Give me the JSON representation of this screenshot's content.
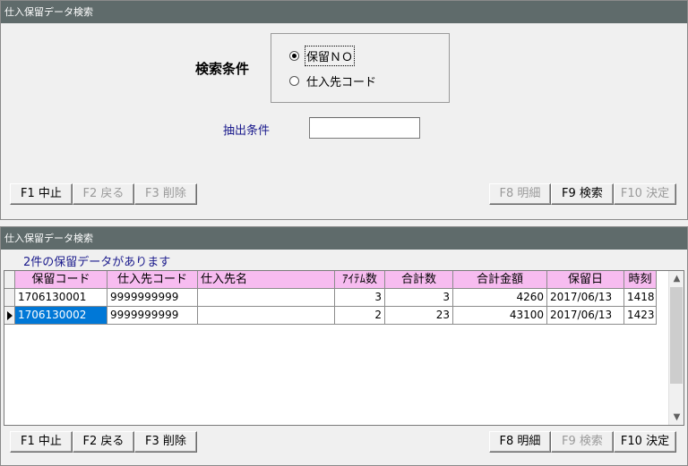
{
  "top_panel": {
    "title": "仕入保留データ検索",
    "search_condition_label": "検索条件",
    "radio_options": [
      {
        "label": "保留ＮＯ",
        "checked": true
      },
      {
        "label": "仕入先コード",
        "checked": false
      }
    ],
    "extract_label": "抽出条件",
    "extract_value": "",
    "buttons": {
      "f1": "F1 中止",
      "f2": "F2 戻る",
      "f3": "F3 削除",
      "f8": "F8 明細",
      "f9": "F9 検索",
      "f10": "F10 決定"
    }
  },
  "bottom_panel": {
    "title": "仕入保留データ検索",
    "count_message": "2件の保留データがあります",
    "columns": [
      "保留コード",
      "仕入先コード",
      "仕入先名",
      "ｱｲﾃﾑ数",
      "合計数",
      "合計金額",
      "保留日",
      "時刻"
    ],
    "rows": [
      {
        "code": "1706130001",
        "supplier_code": "9999999999",
        "supplier_name": "",
        "items": "3",
        "total_qty": "3",
        "total_amount": "4260",
        "date": "2017/06/13",
        "time": "1418"
      },
      {
        "code": "1706130002",
        "supplier_code": "9999999999",
        "supplier_name": "",
        "items": "2",
        "total_qty": "23",
        "total_amount": "43100",
        "date": "2017/06/13",
        "time": "1423"
      }
    ],
    "buttons": {
      "f1": "F1 中止",
      "f2": "F2 戻る",
      "f3": "F3 削除",
      "f8": "F8 明細",
      "f9": "F9 検索",
      "f10": "F10 決定"
    }
  },
  "colors": {
    "titlebar": "#5f6b6b",
    "header_pink": "#f7bcf0",
    "selection": "#0078d7",
    "label_blue": "#1a1a8c"
  }
}
